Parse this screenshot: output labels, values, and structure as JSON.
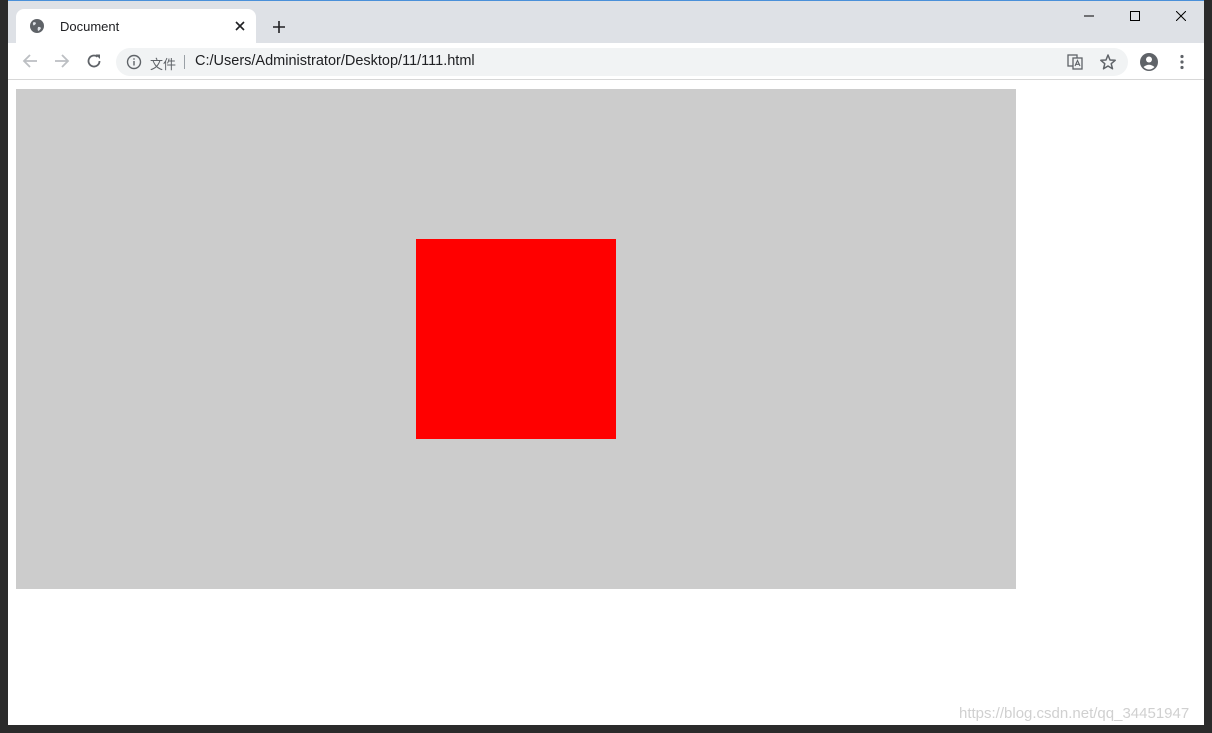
{
  "tab": {
    "title": "Document"
  },
  "address_bar": {
    "scheme_label": "文件",
    "url": "C:/Users/Administrator/Desktop/11/111.html"
  },
  "page": {
    "outer_box_color": "#cccccc",
    "inner_box_color": "#ff0000"
  },
  "watermark": "https://blog.csdn.net/qq_34451947",
  "icons": [
    "globe-icon",
    "close-icon",
    "plus-icon",
    "minimize-icon",
    "maximize-icon",
    "window-close-icon",
    "back-arrow-icon",
    "forward-arrow-icon",
    "reload-icon",
    "info-icon",
    "translate-icon",
    "star-icon",
    "account-icon",
    "kebab-menu-icon"
  ]
}
